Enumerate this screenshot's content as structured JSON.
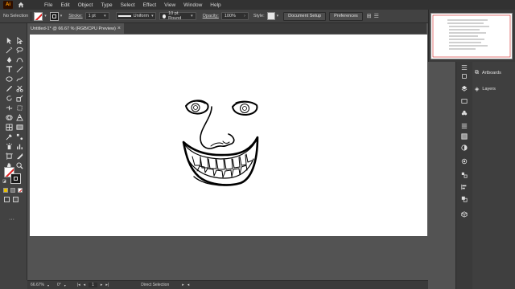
{
  "menubar": {
    "app_logo": "Ai",
    "items": [
      "File",
      "Edit",
      "Object",
      "Type",
      "Select",
      "Effect",
      "View",
      "Window",
      "Help"
    ]
  },
  "control_bar": {
    "selection": "No Selection",
    "stroke_label": "Stroke:",
    "stroke_weight": "1 pt",
    "profile": "Uniform",
    "brush": "10 pt. Round",
    "opacity_label": "Opacity:",
    "opacity_value": "100%",
    "style_label": "Style:",
    "document_setup": "Document Setup",
    "preferences": "Preferences"
  },
  "document": {
    "tab_title": "Untitled-1* @ 66.67 % (RGB/CPU Preview)"
  },
  "panels": {
    "artboards": "Artboards",
    "layers": "Layers"
  },
  "status": {
    "zoom": "66.67%",
    "rotation": "0°",
    "artboard_num": "1",
    "tool": "Direct Selection"
  },
  "colors": {
    "accent_logo": "#ff9a00",
    "ui_dark": "#323232",
    "ui_panel": "#424242",
    "pasteboard": "#535353",
    "artboard": "#ffffff"
  }
}
